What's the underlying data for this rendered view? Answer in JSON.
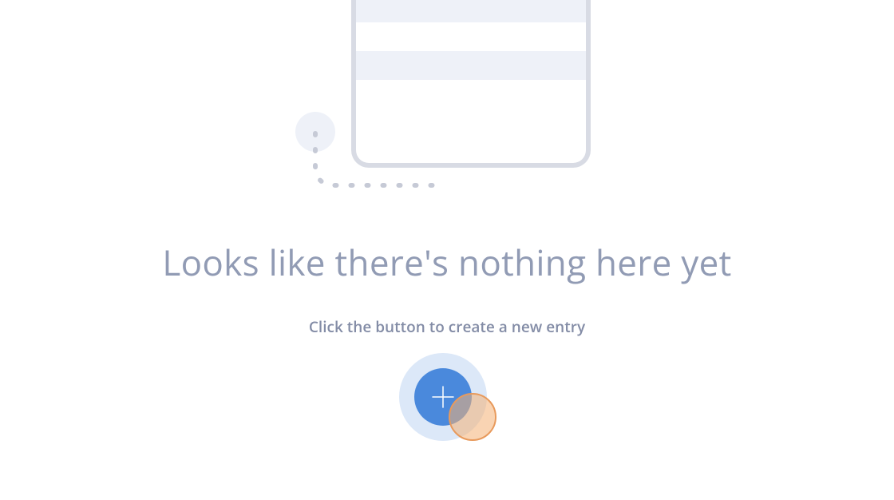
{
  "emptyState": {
    "heading": "Looks like there's nothing here yet",
    "subheading": "Click the button to create a new entry"
  },
  "colors": {
    "accent": "#4a89dc",
    "muted": "#919bb4",
    "highlight": "#e89a5c"
  }
}
